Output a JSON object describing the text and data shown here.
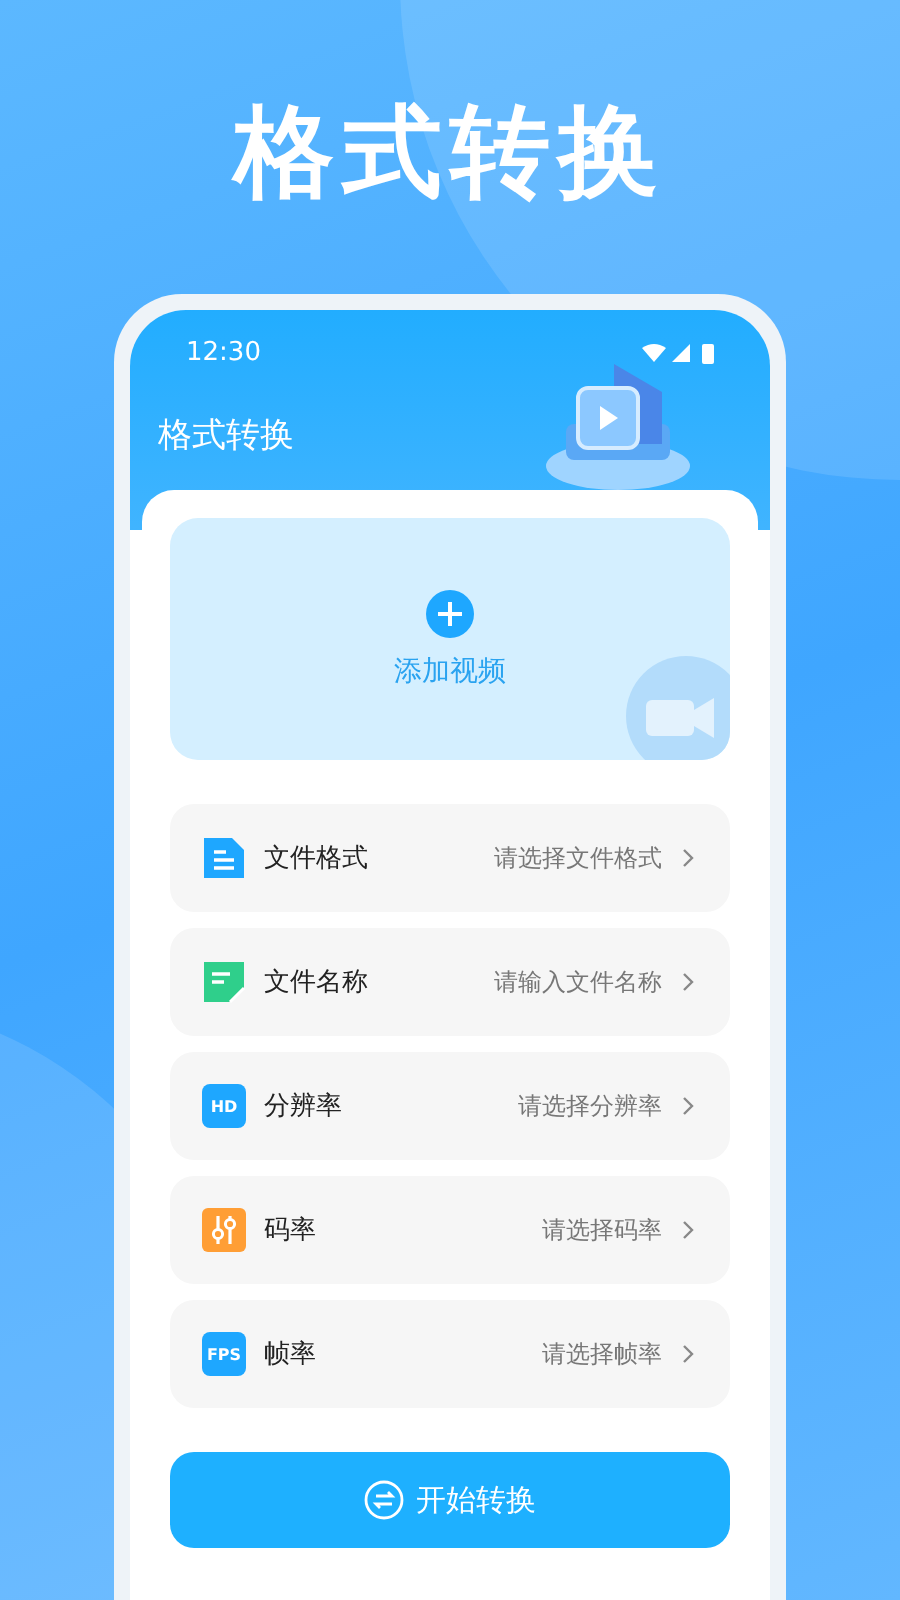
{
  "headline": "格式转换",
  "status_bar": {
    "time": "12:30"
  },
  "app_bar": {
    "title": "格式转换"
  },
  "add_video": {
    "label": "添加视频"
  },
  "settings": [
    {
      "kind": "document",
      "label": "文件格式",
      "value": "请选择文件格式"
    },
    {
      "kind": "edit",
      "label": "文件名称",
      "value": "请输入文件名称"
    },
    {
      "kind": "badge",
      "badge": "HD",
      "label": "分辨率",
      "value": "请选择分辨率"
    },
    {
      "kind": "sliders",
      "label": "码率",
      "value": "请选择码率"
    },
    {
      "kind": "badge",
      "badge": "FPS",
      "label": "帧率",
      "value": "请选择帧率"
    }
  ],
  "start_button": {
    "label": "开始转换"
  }
}
